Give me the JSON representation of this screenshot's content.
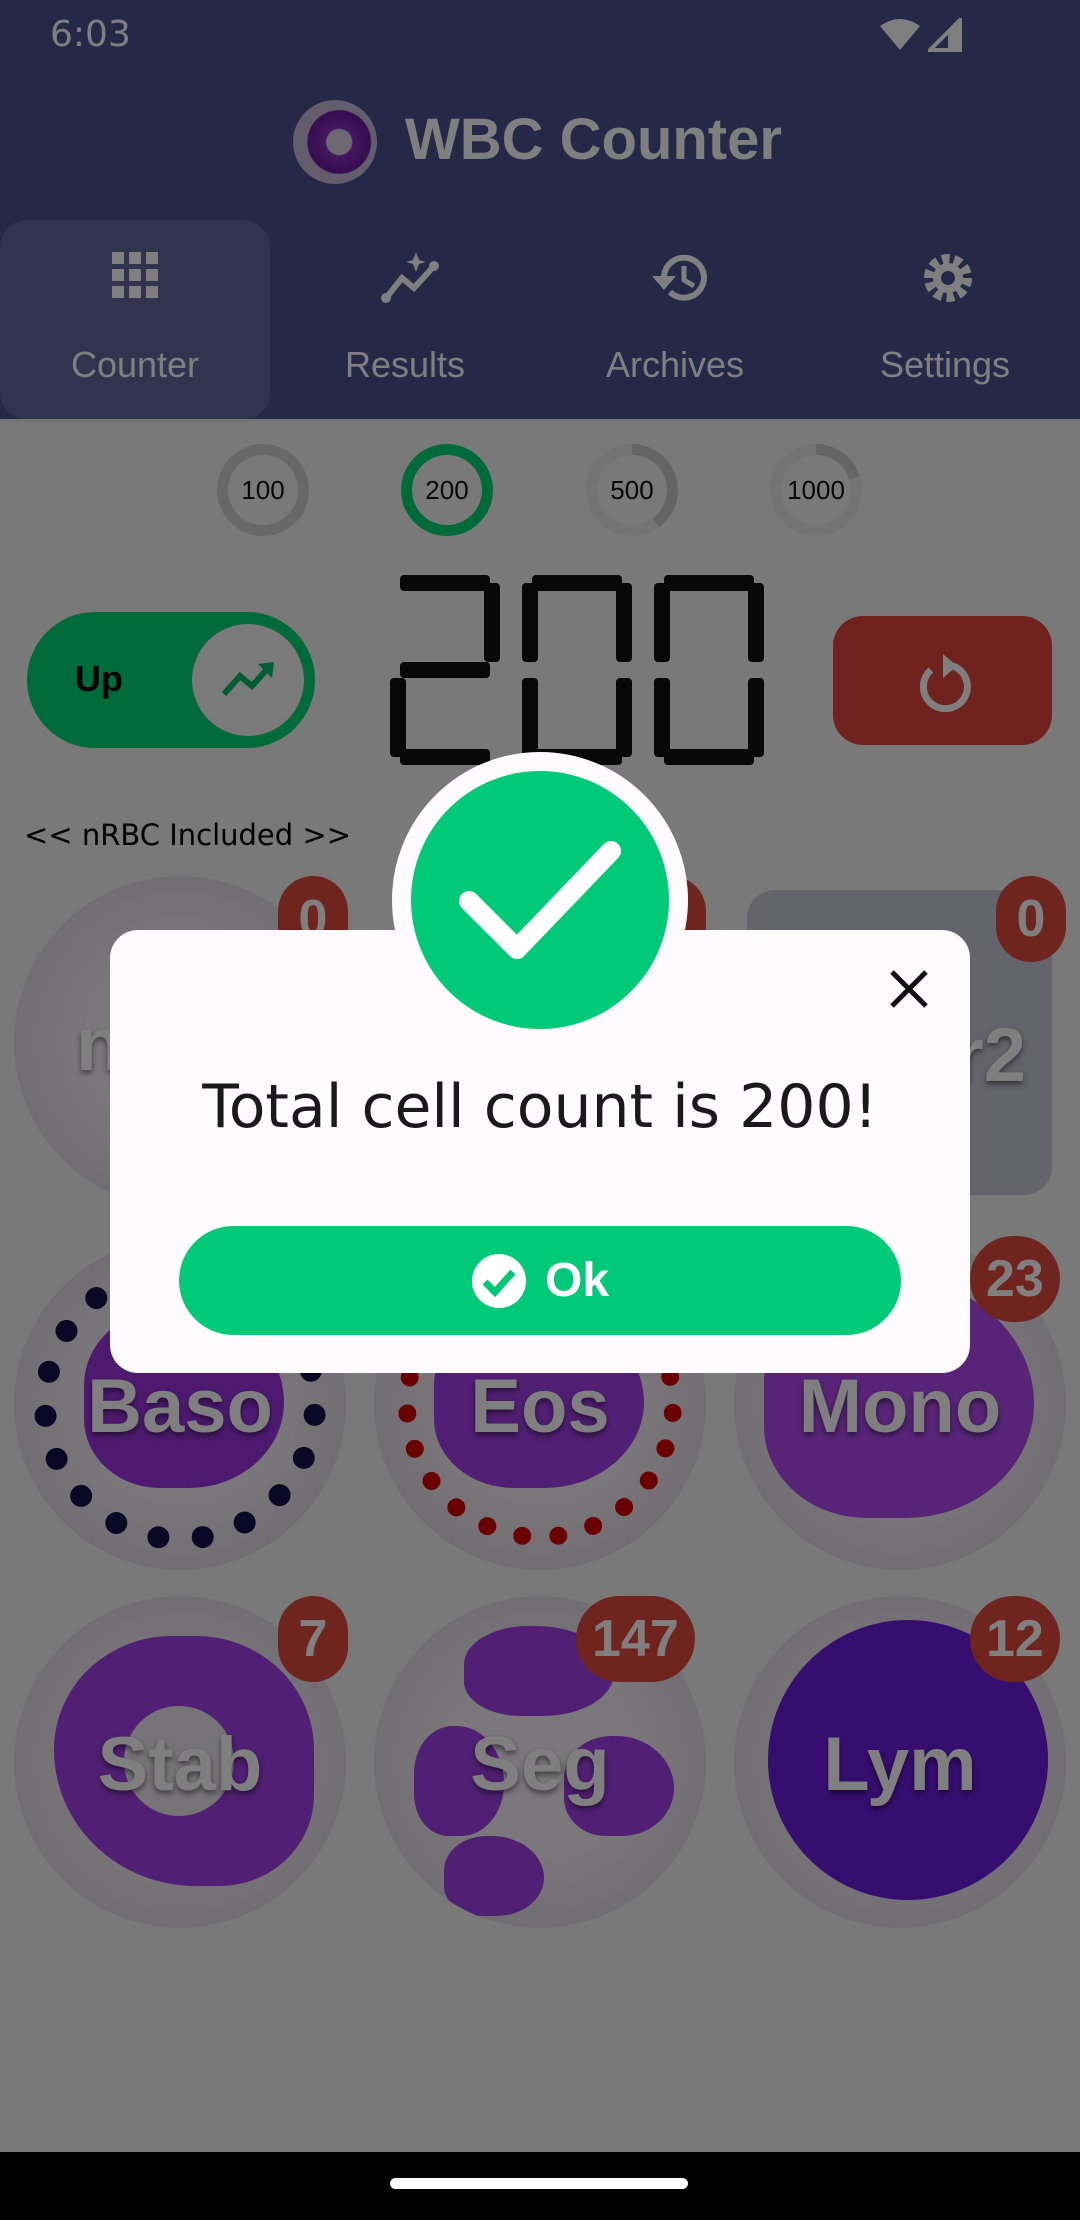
{
  "status_bar": {
    "time": "6:03",
    "icons": [
      "wifi-icon",
      "signal-icon"
    ]
  },
  "app": {
    "title": "WBC Counter"
  },
  "tabs": [
    {
      "label": "Counter",
      "icon": "grid-icon",
      "selected": true
    },
    {
      "label": "Results",
      "icon": "chart-sparkle-icon"
    },
    {
      "label": "Archives",
      "icon": "history-icon"
    },
    {
      "label": "Settings",
      "icon": "gear-icon"
    }
  ],
  "goals": [
    {
      "label": "100",
      "selected": false,
      "progress": 1.0
    },
    {
      "label": "200",
      "selected": true,
      "progress": 1.0
    },
    {
      "label": "500",
      "selected": false,
      "progress": 0.4
    },
    {
      "label": "1000",
      "selected": false,
      "progress": 0.2
    }
  ],
  "toggle": {
    "label": "Up",
    "icon": "trending-up-icon"
  },
  "counter": {
    "value": "200"
  },
  "reset": {
    "icon": "reset-icon"
  },
  "nrbc_note": "<< nRBC Included >>",
  "cells": [
    {
      "label": "n",
      "count": "0"
    },
    {
      "label": "",
      "count": ""
    },
    {
      "label": "r2",
      "count": "0"
    },
    {
      "label": "Baso",
      "count": ""
    },
    {
      "label": "Eos",
      "count": ""
    },
    {
      "label": "Mono",
      "count": "23"
    },
    {
      "label": "Stab",
      "count": "7"
    },
    {
      "label": "Seg",
      "count": "147"
    },
    {
      "label": "Lym",
      "count": "12"
    }
  ],
  "dialog": {
    "message": "Total cell count is 200!",
    "ok_label": "Ok",
    "icon": "check-circle-icon",
    "close_icon": "close-icon"
  },
  "colors": {
    "appbar": "#4c5090",
    "accent_green": "#00c977",
    "badge_red": "#e0483c"
  }
}
